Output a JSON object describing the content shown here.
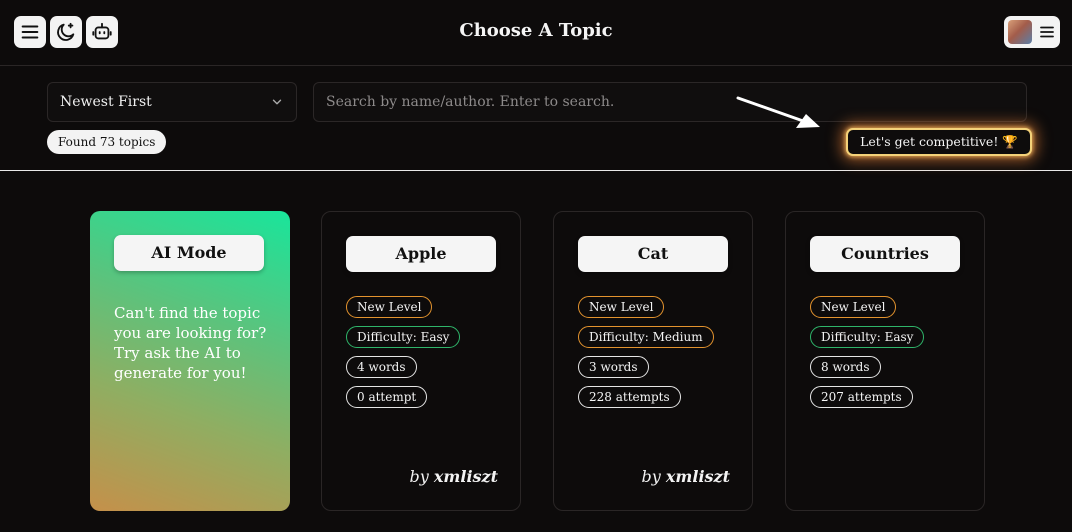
{
  "header": {
    "title": "Choose A Topic",
    "icons": [
      "menu-icon",
      "moon-icon",
      "robot-icon",
      "avatar",
      "hamburger-icon"
    ]
  },
  "filters": {
    "sort_value": "Newest First",
    "search_placeholder": "Search by name/author. Enter to search.",
    "found_label": "Found 73 topics",
    "competitive_label": "Let's get competitive! 🏆"
  },
  "colors": {
    "background": "#0d0b0b",
    "tag_orange": "#e3932e",
    "tag_green": "#2fb56a",
    "ai_gradient_start": "#19e59b",
    "ai_gradient_end": "#c5904a"
  },
  "cards": [
    {
      "title": "AI Mode",
      "description": "Can't find the topic you are looking for? Try ask the AI to generate for you!"
    },
    {
      "title": "Apple",
      "tags": [
        "New Level",
        "Difficulty: Easy",
        "4 words",
        "0 attempt"
      ],
      "author_prefix": "by",
      "author": "xmliszt"
    },
    {
      "title": "Cat",
      "tags": [
        "New Level",
        "Difficulty: Medium",
        "3 words",
        "228 attempts"
      ],
      "author_prefix": "by",
      "author": "xmliszt"
    },
    {
      "title": "Countries",
      "tags": [
        "New Level",
        "Difficulty: Easy",
        "8 words",
        "207 attempts"
      ]
    }
  ]
}
